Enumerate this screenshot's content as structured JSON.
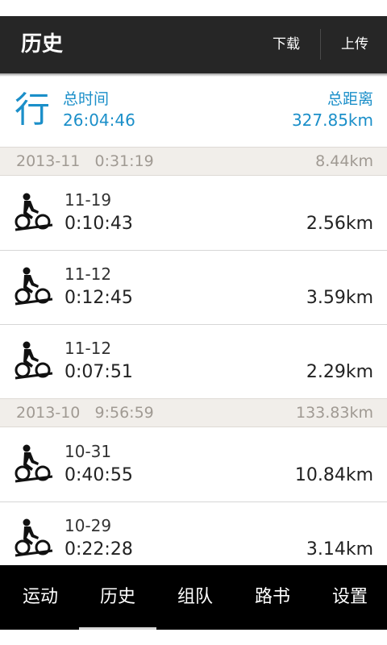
{
  "header": {
    "title": "历史",
    "download_label": "下载",
    "upload_label": "上传"
  },
  "summary": {
    "mode_char": "行",
    "total_time_label": "总时间",
    "total_time": "26:04:46",
    "total_distance_label": "总距离",
    "total_distance": "327.85km"
  },
  "months": [
    {
      "month": "2013-11",
      "time": "0:31:19",
      "distance": "8.44km"
    },
    {
      "month": "2013-10",
      "time": "9:56:59",
      "distance": "133.83km"
    }
  ],
  "rides": [
    {
      "date": "11-19",
      "duration": "0:10:43",
      "distance": "2.56km",
      "icon": "bicycle-icon"
    },
    {
      "date": "11-12",
      "duration": "0:12:45",
      "distance": "3.59km",
      "icon": "bicycle-icon"
    },
    {
      "date": "11-12",
      "duration": "0:07:51",
      "distance": "2.29km",
      "icon": "bicycle-icon"
    },
    {
      "date": "10-31",
      "duration": "0:40:55",
      "distance": "10.84km",
      "icon": "bicycle-icon"
    },
    {
      "date": "10-29",
      "duration": "0:22:28",
      "distance": "3.14km",
      "icon": "bicycle-icon"
    }
  ],
  "nav": {
    "tabs": [
      {
        "label": "运动"
      },
      {
        "label": "历史"
      },
      {
        "label": "组队"
      },
      {
        "label": "路书"
      },
      {
        "label": "设置"
      }
    ],
    "active": "历史"
  },
  "colors": {
    "accent": "#1b8fc9",
    "topbar": "#262626",
    "navbar": "#000000",
    "month_bg": "#f1eeea"
  }
}
